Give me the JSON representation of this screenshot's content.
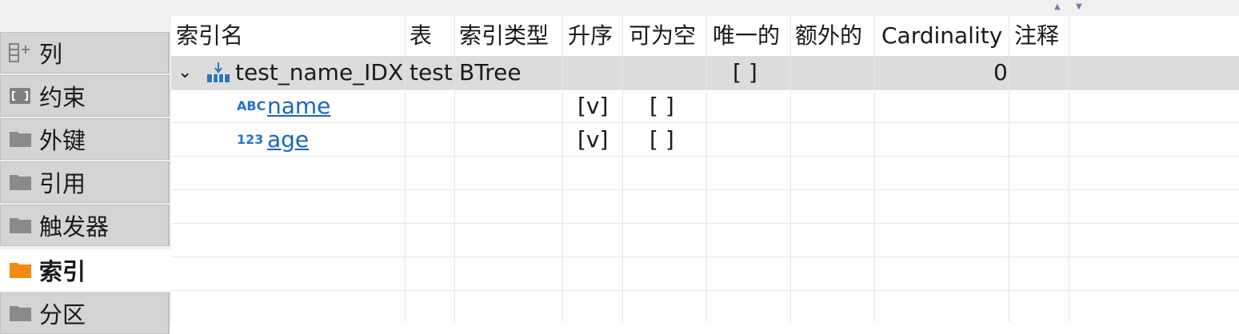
{
  "toolbar": {
    "sort_up_icon": "triangle-up-icon",
    "sort_down_icon": "triangle-down-icon"
  },
  "sidebar": {
    "tabs": [
      {
        "label": "列",
        "icon": "columns-icon"
      },
      {
        "label": "约束",
        "icon": "constraint-icon"
      },
      {
        "label": "外键",
        "icon": "folder-icon"
      },
      {
        "label": "引用",
        "icon": "folder-icon"
      },
      {
        "label": "触发器",
        "icon": "folder-icon"
      },
      {
        "label": "索引",
        "icon": "folder-icon",
        "active": true,
        "color": "#f28a11"
      },
      {
        "label": "分区",
        "icon": "folder-icon"
      }
    ]
  },
  "table": {
    "columns": [
      "索引名",
      "表",
      "索引类型",
      "升序",
      "可为空",
      "唯一的",
      "额外的",
      "Cardinality",
      "注释"
    ],
    "index_row": {
      "name": "test_name_IDX",
      "table": "test",
      "type": "BTree",
      "unique": "[  ]",
      "cardinality": "0"
    },
    "column_rows": [
      {
        "type_icon": "ABC",
        "name": "name",
        "asc": "[v]",
        "nullable": "[  ]"
      },
      {
        "type_icon": "123",
        "name": "age",
        "asc": "[v]",
        "nullable": "[  ]"
      }
    ]
  },
  "colors": {
    "active_folder": "#f28a11",
    "inactive_folder": "#8a8a8a",
    "link": "#1b65c2",
    "selected_row": "#dcdcdc"
  }
}
